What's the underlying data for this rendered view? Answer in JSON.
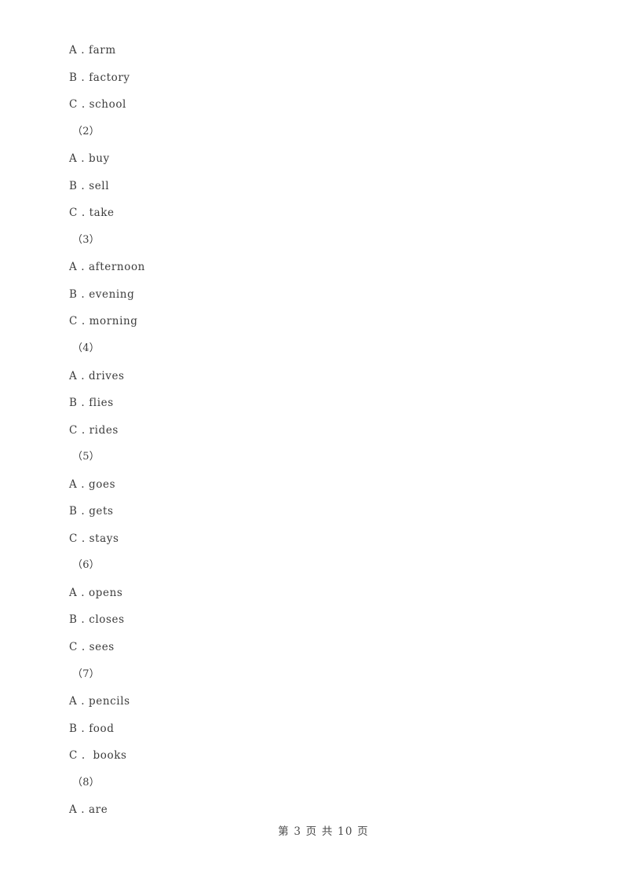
{
  "document": {
    "page_background": "#ffffff",
    "text_color": "#3c3c3c",
    "footer_color": "#4a4a4a"
  },
  "body_lines": [
    {
      "kind": "option",
      "text": "A . farm"
    },
    {
      "kind": "option",
      "text": "B . factory"
    },
    {
      "kind": "option",
      "text": "C . school"
    },
    {
      "kind": "qnum",
      "text": "（2）"
    },
    {
      "kind": "option",
      "text": "A . buy"
    },
    {
      "kind": "option",
      "text": "B . sell"
    },
    {
      "kind": "option",
      "text": "C . take"
    },
    {
      "kind": "qnum",
      "text": "（3）"
    },
    {
      "kind": "option",
      "text": "A . afternoon"
    },
    {
      "kind": "option",
      "text": "B . evening"
    },
    {
      "kind": "option",
      "text": "C . morning"
    },
    {
      "kind": "qnum",
      "text": "（4）"
    },
    {
      "kind": "option",
      "text": "A . drives"
    },
    {
      "kind": "option",
      "text": "B . flies"
    },
    {
      "kind": "option",
      "text": "C . rides"
    },
    {
      "kind": "qnum",
      "text": "（5）"
    },
    {
      "kind": "option",
      "text": "A . goes"
    },
    {
      "kind": "option",
      "text": "B . gets"
    },
    {
      "kind": "option",
      "text": "C . stays"
    },
    {
      "kind": "qnum",
      "text": "（6）"
    },
    {
      "kind": "option",
      "text": "A . opens"
    },
    {
      "kind": "option",
      "text": "B . closes"
    },
    {
      "kind": "option",
      "text": "C . sees"
    },
    {
      "kind": "qnum",
      "text": "（7）"
    },
    {
      "kind": "option",
      "text": "A . pencils"
    },
    {
      "kind": "option",
      "text": "B . food"
    },
    {
      "kind": "option",
      "text": "C .  books"
    },
    {
      "kind": "qnum",
      "text": "（8）"
    },
    {
      "kind": "option",
      "text": "A . are"
    }
  ],
  "footer": {
    "text": "第 3 页 共 10 页",
    "current_page": "3",
    "total_pages": "10"
  }
}
